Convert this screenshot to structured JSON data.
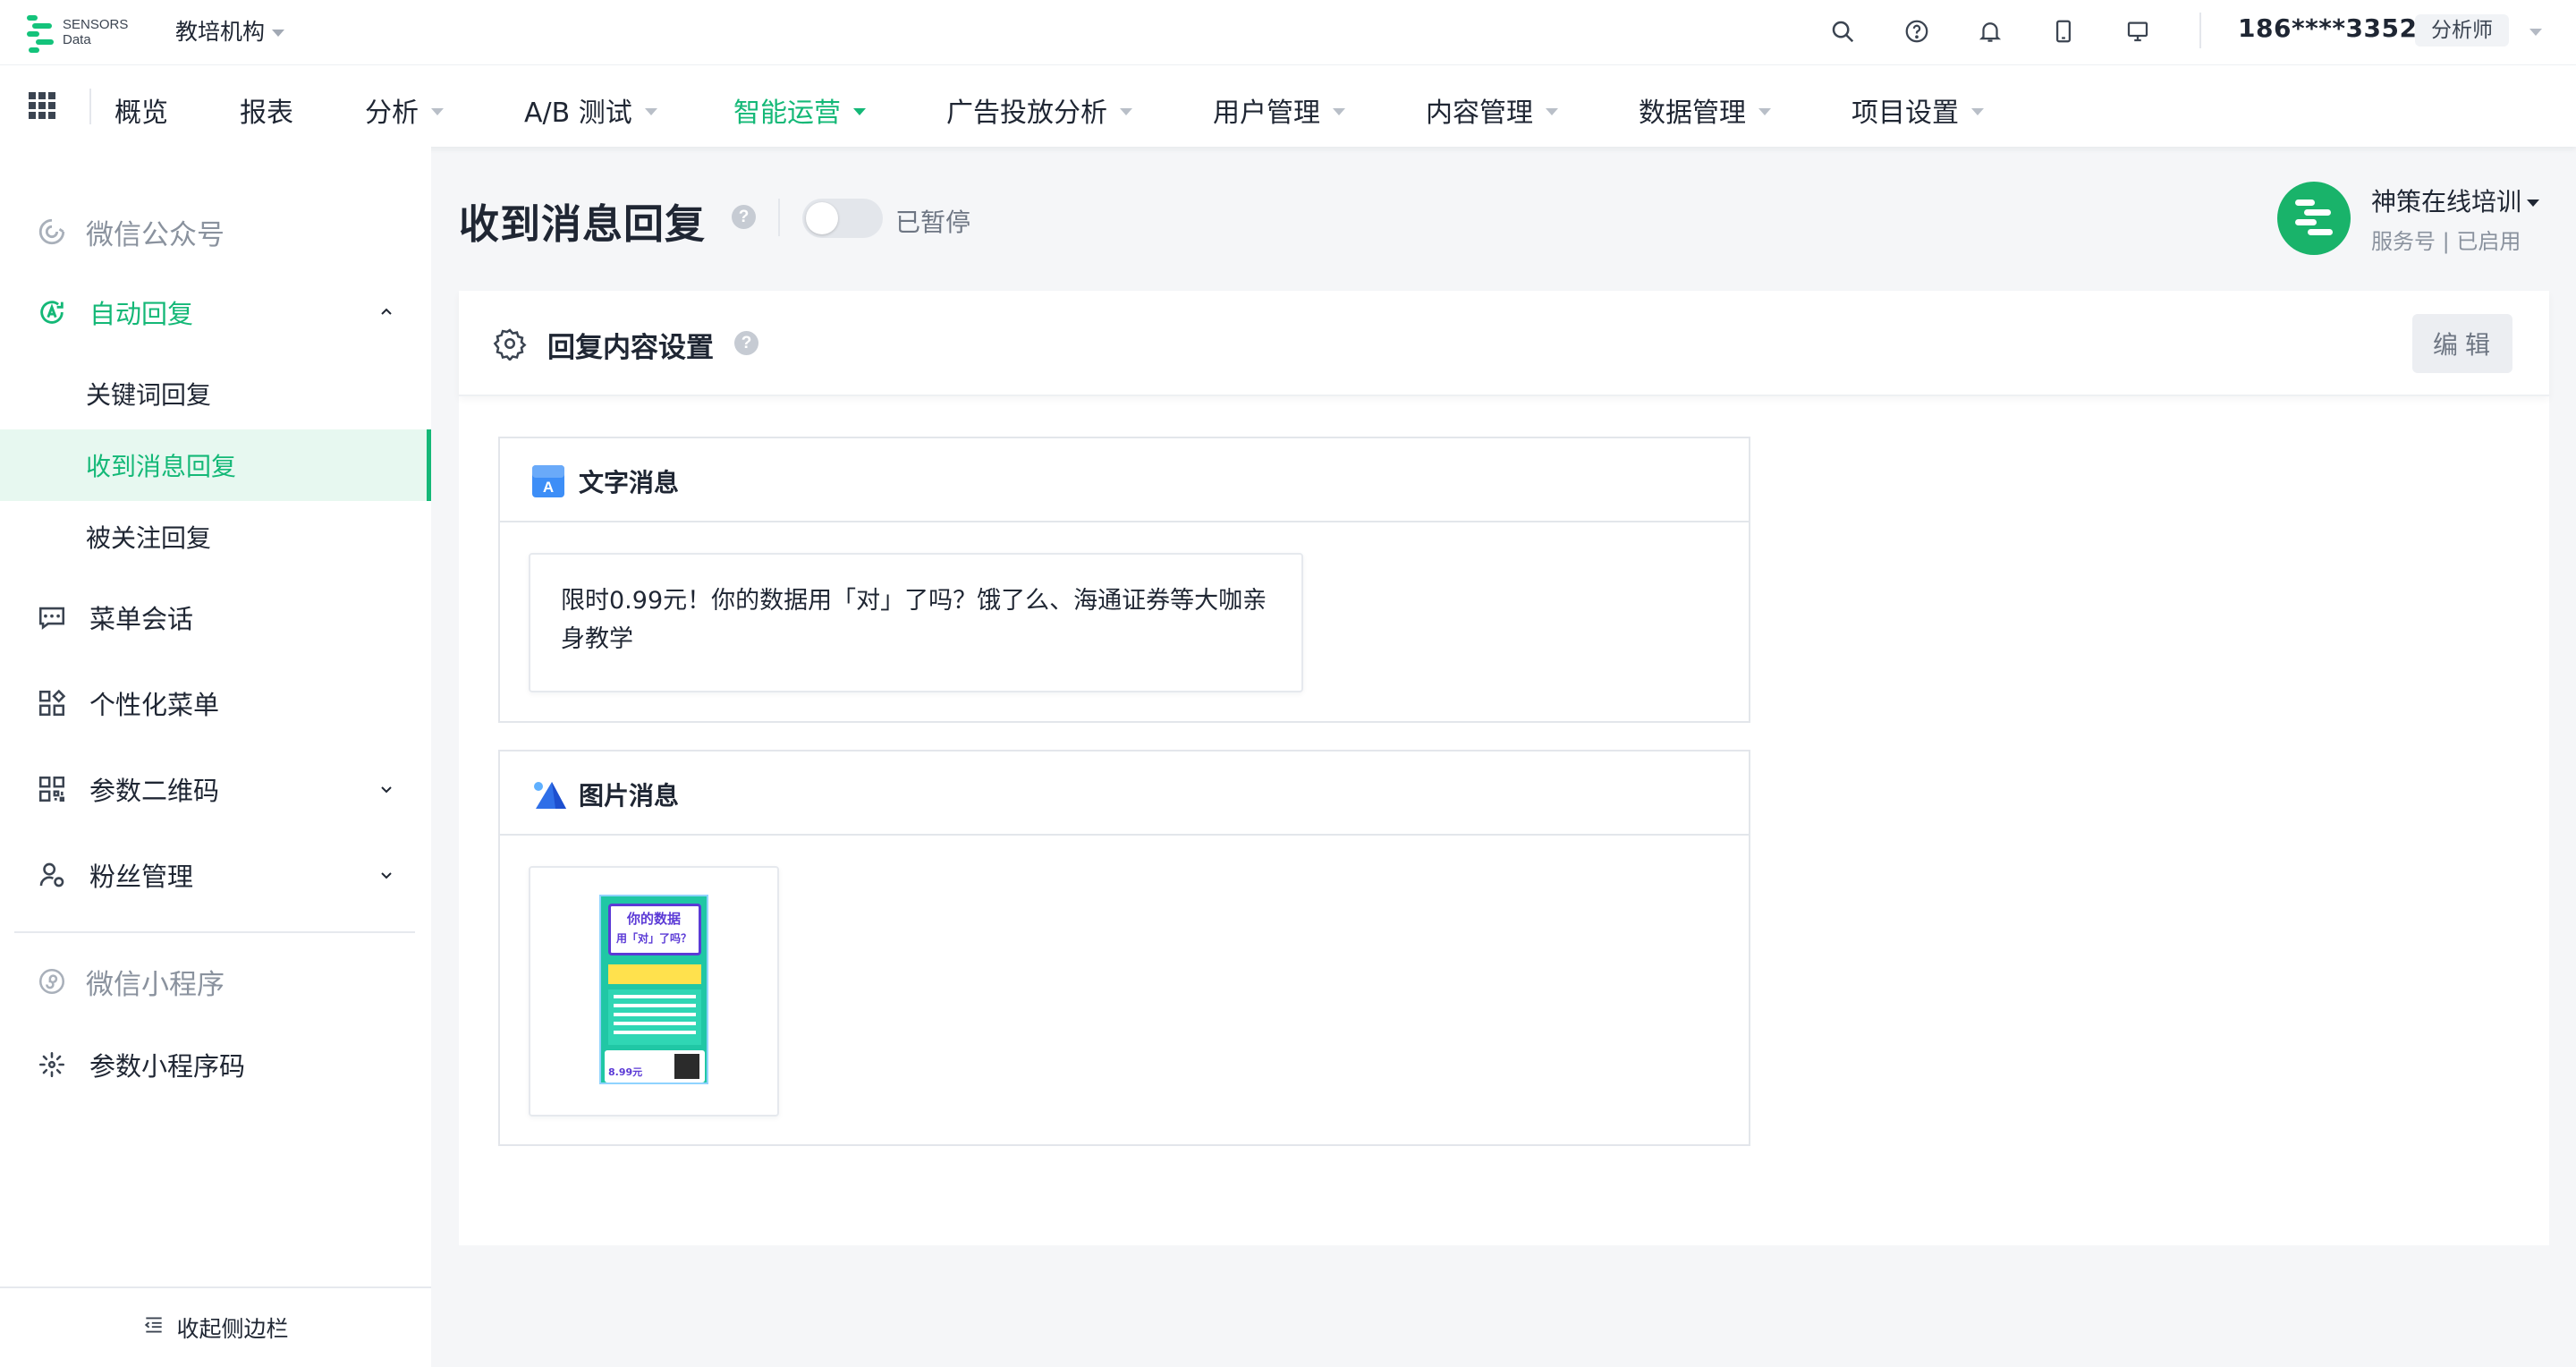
{
  "brand": {
    "logo_line1": "SENSORS",
    "logo_line2": "Data",
    "org_name": "教培机构",
    "accent": "#14b877"
  },
  "topbar": {
    "icons": [
      "search-icon",
      "help-circle-icon",
      "bell-icon",
      "mobile-icon",
      "monitor-icon"
    ],
    "user_phone": "186****3352",
    "user_role": "分析师"
  },
  "nav": {
    "items": [
      {
        "label": "概览"
      },
      {
        "label": "报表"
      },
      {
        "label": "分析"
      },
      {
        "label": "A/B 测试"
      },
      {
        "label": "智能运营"
      },
      {
        "label": "广告投放分析"
      },
      {
        "label": "用户管理"
      },
      {
        "label": "内容管理"
      },
      {
        "label": "数据管理"
      },
      {
        "label": "项目设置"
      }
    ],
    "active": "智能运营"
  },
  "sidebar": {
    "wechat_group": "微信公众号",
    "auto_reply": "自动回复",
    "keyword_reply": "关键词回复",
    "message_reply": "收到消息回复",
    "follow_reply": "被关注回复",
    "menu_conversation": "菜单会话",
    "custom_menu": "个性化菜单",
    "param_qrcode": "参数二维码",
    "fans_manage": "粉丝管理",
    "miniprogram_group": "微信小程序",
    "param_miniprogram_code": "参数小程序码",
    "collapse": "收起侧边栏"
  },
  "page": {
    "title": "收到消息回复",
    "status_label": "已暂停",
    "status_enabled": false
  },
  "account": {
    "name": "神策在线培训",
    "meta": "服务号 | 已启用"
  },
  "card": {
    "title": "回复内容设置",
    "edit_label": "编辑",
    "text_message": {
      "title": "文字消息",
      "content": "限时0.99元！你的数据用「对」了吗？饿了么、海通证券等大咖亲身教学"
    },
    "image_message": {
      "title": "图片消息",
      "poster_heading_1": "你的数据",
      "poster_heading_2": "用「对」了吗？",
      "poster_price": "8.99元"
    }
  }
}
